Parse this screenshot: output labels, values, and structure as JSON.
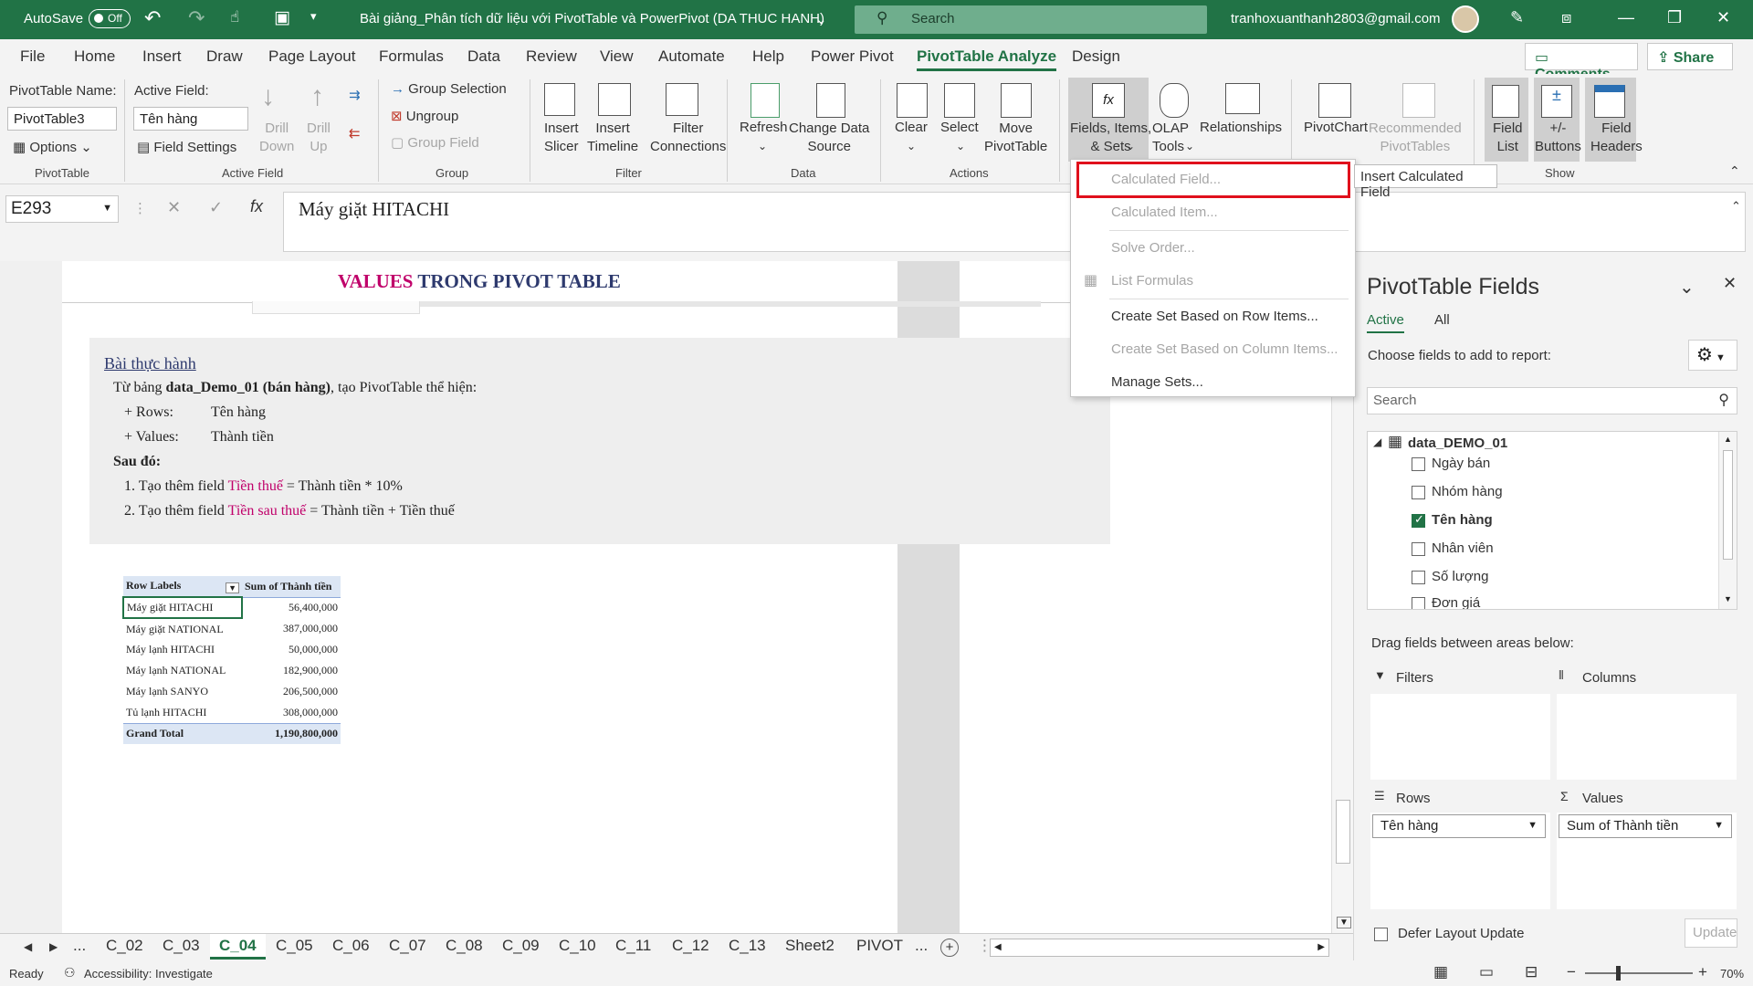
{
  "titlebar": {
    "autosave": "AutoSave",
    "toggle": "Off",
    "title": "Bài giảng_Phân tích dữ liệu với PivotTable và PowerPivot (DA THUC HANH)",
    "search": "Search",
    "user": "tranhoxuanthanh2803@gmail.com"
  },
  "menu_tabs": [
    "File",
    "Home",
    "Insert",
    "Draw",
    "Page Layout",
    "Formulas",
    "Data",
    "Review",
    "View",
    "Automate",
    "Help",
    "Power Pivot",
    "PivotTable Analyze",
    "Design"
  ],
  "comments_label": "Comments",
  "share_label": "Share",
  "ribbon": {
    "pt_name_label": "PivotTable Name:",
    "pt_name": "PivotTable3",
    "options": "Options",
    "grp_pivottable": "PivotTable",
    "active_field_label": "Active Field:",
    "active_field": "Tên hàng",
    "field_settings": "Field Settings",
    "drill_down": "Drill\nDown",
    "drill_up": "Drill\nUp",
    "grp_active": "Active Field",
    "group_selection": "Group Selection",
    "ungroup": "Ungroup",
    "group_field": "Group Field",
    "grp_group": "Group",
    "insert_slicer": "Insert\nSlicer",
    "insert_timeline": "Insert\nTimeline",
    "filter_connections": "Filter\nConnections",
    "grp_filter": "Filter",
    "refresh": "Refresh",
    "change_source": "Change Data\nSource",
    "grp_data": "Data",
    "clear": "Clear",
    "select": "Select",
    "move_pt": "Move\nPivotTable",
    "grp_actions": "Actions",
    "fields_items": "Fields, Items,\n& Sets",
    "olap": "OLAP\nTools",
    "relationships": "Relationships",
    "pivotchart": "PivotChart",
    "recommended": "Recommended\nPivotTables",
    "field_list": "Field\nList",
    "buttons": "+/-\nButtons",
    "field_headers": "Field\nHeaders",
    "grp_show": "Show"
  },
  "formula_bar": {
    "name_box": "E293",
    "formula": "Máy giặt HITACHI"
  },
  "sheet": {
    "heading_a": "VALUES",
    "heading_b": " TRONG PIVOT TABLE",
    "bai": "Bài thực hành",
    "l1_a": "Từ bảng ",
    "l1_b": "data_Demo_01 (bán hàng)",
    "l1_c": ", tạo PivotTable thể hiện:",
    "rows_k": "+ Rows:",
    "rows_v": "Tên hàng",
    "values_k": "+ Values:",
    "values_v": "Thành tiền",
    "sau_do": "Sau đó:",
    "s1_a": "1. Tạo thêm field ",
    "s1_b": "Tiền thuế",
    "s1_c": " = Thành tiền * 10%",
    "s2_a": "2. Tạo thêm field ",
    "s2_b": "Tiền sau thuế",
    "s2_c": " = Thành tiền + Tiền thuế",
    "pivot_header": [
      "Row Labels",
      "Sum of Thành tiền"
    ],
    "pivot_rows": [
      [
        "Máy giặt HITACHI",
        "56,400,000"
      ],
      [
        "Máy giặt NATIONAL",
        "387,000,000"
      ],
      [
        "Máy lạnh HITACHI",
        "50,000,000"
      ],
      [
        "Máy lạnh NATIONAL",
        "182,900,000"
      ],
      [
        "Máy lạnh SANYO",
        "206,500,000"
      ],
      [
        "Tủ lạnh HITACHI",
        "308,000,000"
      ]
    ],
    "grand_total": [
      "Grand Total",
      "1,190,800,000"
    ]
  },
  "dropdown": {
    "items": [
      "Calculated Field...",
      "Calculated Item...",
      "Solve Order...",
      "List Formulas",
      "Create Set Based on Row Items...",
      "Create Set Based on Column Items...",
      "Manage Sets..."
    ],
    "tooltip": "Insert Calculated Field"
  },
  "sheet_tabs": [
    "...",
    "C_02",
    "C_03",
    "C_04",
    "C_05",
    "C_06",
    "C_07",
    "C_08",
    "C_09",
    "C_10",
    "C_11",
    "C_12",
    "C_13",
    "Sheet2",
    "PIVOT",
    "..."
  ],
  "status": {
    "ready": "Ready",
    "accessibility": "Accessibility: Investigate",
    "zoom": "70%"
  },
  "panel": {
    "title": "PivotTable Fields",
    "tab_active": "Active",
    "tab_all": "All",
    "choose": "Choose fields to add to report:",
    "search": "Search",
    "table": "data_DEMO_01",
    "fields": [
      {
        "name": "Ngày bán",
        "checked": false
      },
      {
        "name": "Nhóm hàng",
        "checked": false
      },
      {
        "name": "Tên hàng",
        "checked": true
      },
      {
        "name": "Nhân viên",
        "checked": false
      },
      {
        "name": "Số lượng",
        "checked": false
      },
      {
        "name": "Đơn giá",
        "checked": false
      }
    ],
    "drag": "Drag fields between areas below:",
    "filters": "Filters",
    "columns": "Columns",
    "rows": "Rows",
    "values": "Values",
    "rows_item": "Tên hàng",
    "values_item": "Sum of Thành tiền",
    "defer": "Defer Layout Update",
    "update": "Update"
  },
  "colors": {
    "excel_green": "#217346",
    "highlight_red": "#e0101c",
    "heading_pink": "#c0006a",
    "heading_navy": "#2e3a6e"
  }
}
